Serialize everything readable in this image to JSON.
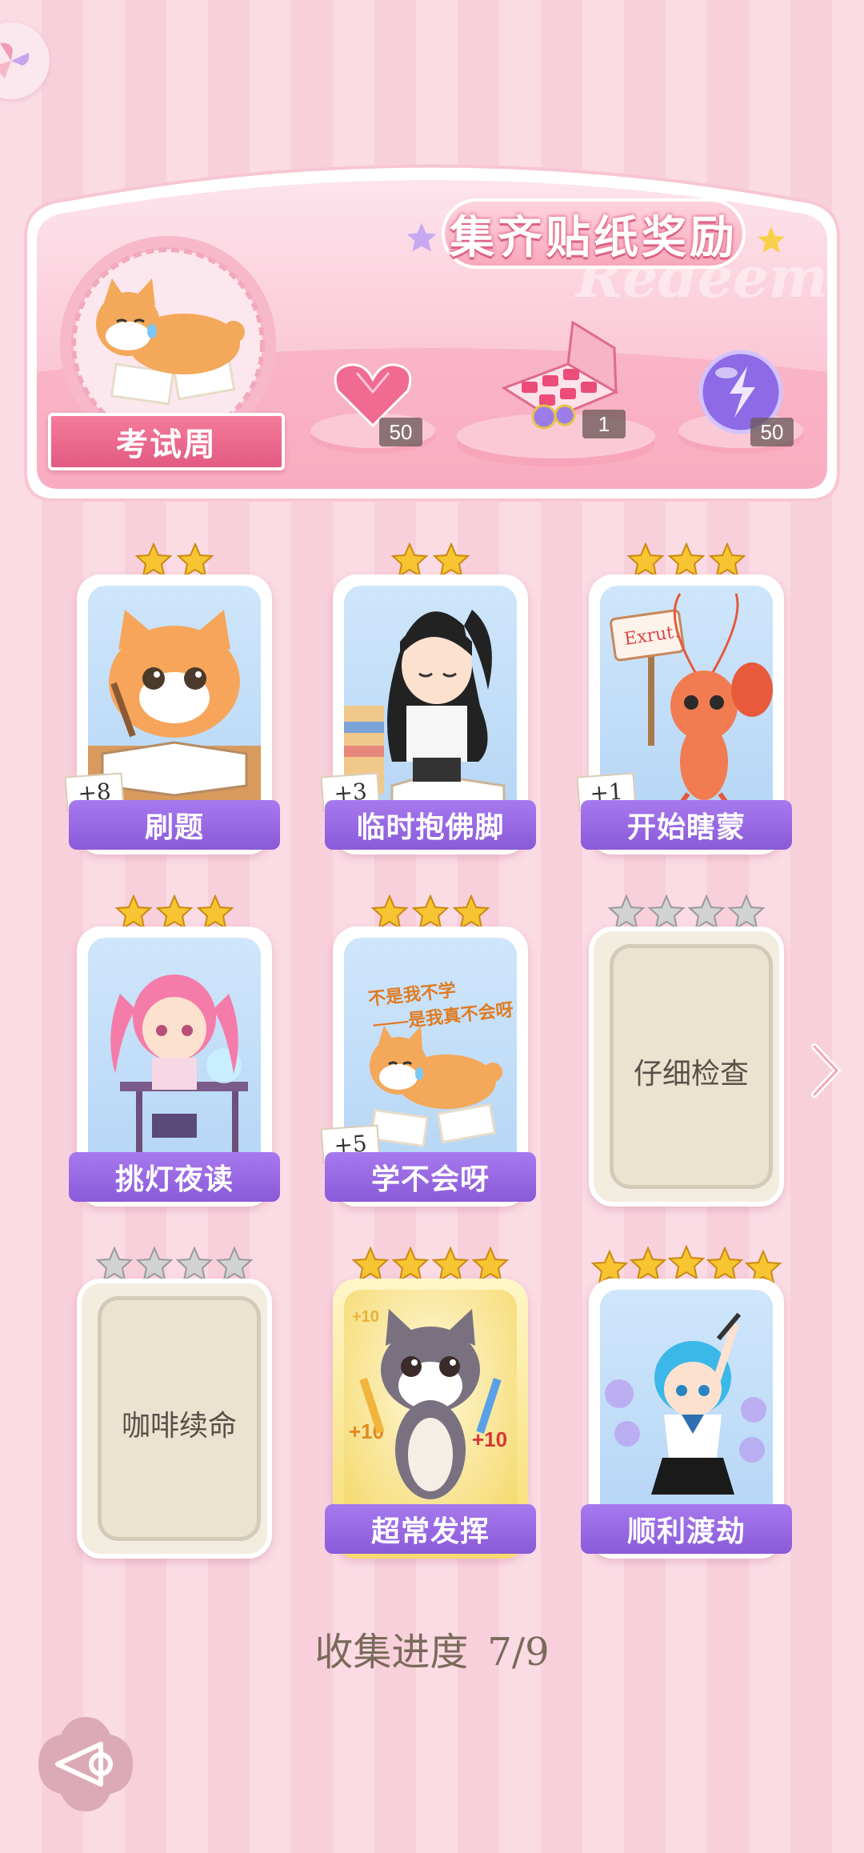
{
  "banner": {
    "title": "集齐贴纸奖励",
    "watermark": "Redeem",
    "badge_label": "考试周",
    "rewards": [
      {
        "icon": "pink-heart-gem-icon",
        "count": "50"
      },
      {
        "icon": "gift-box-icon",
        "count": "1"
      },
      {
        "icon": "purple-energy-orb-icon",
        "count": "50"
      }
    ]
  },
  "cards": [
    {
      "label": "刷题",
      "stars": 2,
      "bonus": "+8",
      "collected": true
    },
    {
      "label": "临时抱佛脚",
      "stars": 2,
      "bonus": "+3",
      "collected": true
    },
    {
      "label": "开始瞎蒙",
      "stars": 3,
      "bonus": "+1",
      "collected": true,
      "sign_text": "Exrut!"
    },
    {
      "label": "挑灯夜读",
      "stars": 3,
      "bonus": "",
      "collected": true
    },
    {
      "label": "学不会呀",
      "stars": 3,
      "bonus": "+5",
      "collected": true,
      "art_text_1": "不是我不学",
      "art_text_2": "——是我真不会呀"
    },
    {
      "label": "仔细检查",
      "stars": 4,
      "bonus": "",
      "collected": false
    },
    {
      "label": "咖啡续命",
      "stars": 4,
      "bonus": "",
      "collected": false
    },
    {
      "label": "超常发挥",
      "stars": 4,
      "bonus": "",
      "collected": true,
      "art_text_1": "+10",
      "art_text_2": "+10",
      "art_text_3": "+10"
    },
    {
      "label": "顺利渡劫",
      "stars": 5,
      "bonus": "",
      "collected": true
    }
  ],
  "progress": {
    "label": "收集进度",
    "value": "7/9"
  },
  "colors": {
    "ribbon": "#9b6ae3",
    "banner": "#f7a9bc",
    "star_gold": "#f7c531",
    "star_grey": "#c9c9c9"
  },
  "icons": {
    "pinwheel": "pinwheel-icon",
    "next": "chevron-right-icon",
    "back": "back-arrow-icon"
  }
}
